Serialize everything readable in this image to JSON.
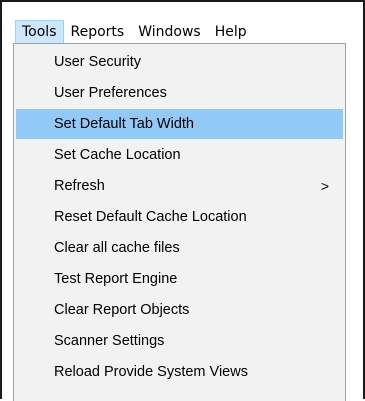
{
  "menubar": {
    "items": [
      {
        "label": "Tools",
        "active": true
      },
      {
        "label": "Reports",
        "active": false
      },
      {
        "label": "Windows",
        "active": false
      },
      {
        "label": "Help",
        "active": false
      }
    ]
  },
  "tools_menu": {
    "items": [
      {
        "label": "User Security",
        "highlighted": false,
        "has_submenu": false
      },
      {
        "label": "User Preferences",
        "highlighted": false,
        "has_submenu": false
      },
      {
        "label": "Set Default Tab Width",
        "highlighted": true,
        "has_submenu": false
      },
      {
        "label": "Set Cache Location",
        "highlighted": false,
        "has_submenu": false
      },
      {
        "label": "Refresh",
        "highlighted": false,
        "has_submenu": true,
        "submenu_glyph": ">"
      },
      {
        "label": "Reset Default Cache Location",
        "highlighted": false,
        "has_submenu": false
      },
      {
        "label": "Clear all cache files",
        "highlighted": false,
        "has_submenu": false
      },
      {
        "label": "Test Report Engine",
        "highlighted": false,
        "has_submenu": false
      },
      {
        "label": "Clear Report Objects",
        "highlighted": false,
        "has_submenu": false
      },
      {
        "label": "Scanner Settings",
        "highlighted": false,
        "has_submenu": false
      },
      {
        "label": "Reload Provide System Views",
        "highlighted": false,
        "has_submenu": false
      }
    ]
  },
  "colors": {
    "menubar_active_bg": "#cce8ff",
    "menu_highlight_bg": "#91c9f7",
    "menu_bg": "#f2f2f2"
  }
}
